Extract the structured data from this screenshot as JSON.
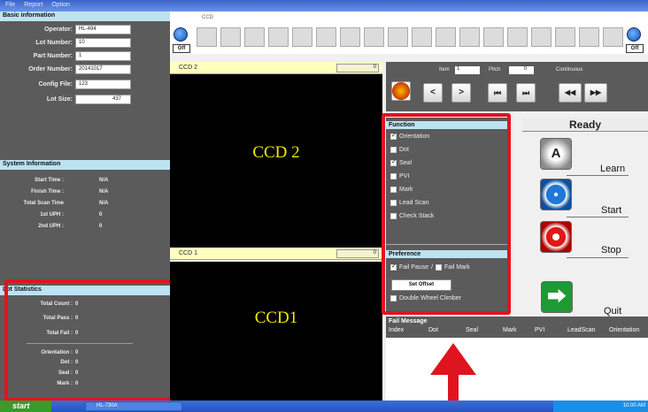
{
  "menu": [
    "File",
    "Report",
    "Option"
  ],
  "basic_info": {
    "title": "Basic information",
    "fields": [
      {
        "label": "Operator:",
        "value": "HL-494"
      },
      {
        "label": "Lot Number:",
        "value": "10"
      },
      {
        "label": "Part Number:",
        "value": "1"
      },
      {
        "label": "Order Number:",
        "value": "20141017"
      },
      {
        "label": "Config File:",
        "value": "123"
      },
      {
        "label": "Lot Size:",
        "value": "437"
      }
    ]
  },
  "system_info": {
    "title": "System Information",
    "rows": [
      {
        "label": "Start Time :",
        "value": "N/A"
      },
      {
        "label": "Finish Time :",
        "value": "N/A"
      },
      {
        "label": "Total Scan Time",
        "value": "N/A"
      },
      {
        "label": "1st UPH :",
        "value": "0"
      },
      {
        "label": "2nd UPH :",
        "value": "0"
      }
    ]
  },
  "lot_stats": {
    "title": "Lot Statistics",
    "rows": [
      {
        "label": "Total Count :",
        "value": "0"
      },
      {
        "label": "Total Pass :",
        "value": "0"
      },
      {
        "label": "Total Fail :",
        "value": "0"
      },
      {
        "label": "Orientation :",
        "value": "0"
      },
      {
        "label": "Dot :",
        "value": "0"
      },
      {
        "label": "Seal :",
        "value": "0"
      },
      {
        "label": "Mark :",
        "value": "0"
      }
    ]
  },
  "top": {
    "ccd_label": "CCD",
    "off_left": "Off",
    "off_right": "Off"
  },
  "ccd2": {
    "header": "CCD 2",
    "count": "0",
    "view_label": "CCD 2"
  },
  "ccd1": {
    "header": "CCD 1",
    "count": "0",
    "view_label": "CCD1"
  },
  "controls": {
    "item_label": "Item",
    "item_value": "1",
    "pitch_label": "Pitch",
    "pitch_value": "0",
    "continuous_label": "Continuous",
    "prev": "<",
    "next": ">",
    "first": "⏮",
    "last": "⏭",
    "rew": "◀◀",
    "ff": "▶▶"
  },
  "function": {
    "title": "Function",
    "items": [
      {
        "label": "Orientation",
        "checked": true
      },
      {
        "label": "Dot",
        "checked": false
      },
      {
        "label": "Seal",
        "checked": true
      },
      {
        "label": "PVI",
        "checked": false
      },
      {
        "label": "Mark",
        "checked": false
      },
      {
        "label": "Lead Scan",
        "checked": false
      },
      {
        "label": "Check Stack",
        "checked": false
      }
    ]
  },
  "preference": {
    "title": "Preference",
    "fail_pause": "Fail Pause",
    "separator": "/",
    "fail_mark": "Fail Mark",
    "set_offset": "Set Offset",
    "double_wheel": "Double Wheel Climber"
  },
  "status": {
    "ready": "Ready"
  },
  "actions": {
    "learn": "Learn",
    "start": "Start",
    "stop": "Stop",
    "quit": "Quit",
    "learn_icon_text": "A"
  },
  "fail_message": {
    "title": "Fail Message",
    "columns": [
      "Index",
      "Dot",
      "Seal",
      "Mark",
      "PVI",
      "LeadScan",
      "Orientation"
    ]
  },
  "taskbar": {
    "start": "start",
    "task": "HL-730A",
    "clock": "10:00 AM"
  },
  "colors": {
    "highlight": "#e0141e",
    "panel": "#5b5b5b",
    "header": "#bde2f2"
  }
}
